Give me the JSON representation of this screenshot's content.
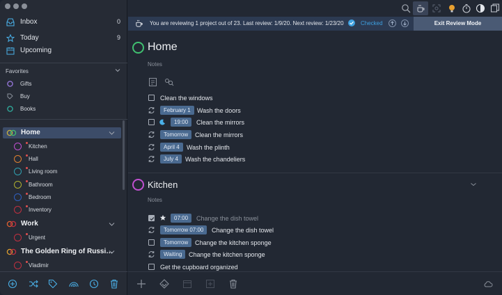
{
  "sidebar": {
    "top_items": [
      {
        "label": "Inbox",
        "count": "0"
      },
      {
        "label": "Today",
        "count": "9"
      },
      {
        "label": "Upcoming",
        "count": ""
      }
    ],
    "favorites_header": "Favorites",
    "favorites": [
      {
        "label": "Gifts",
        "color": "#9a7ae0"
      },
      {
        "label": "Buy",
        "color": "#8a909a"
      },
      {
        "label": "Books",
        "color": "#30b0a0"
      }
    ],
    "projects": [
      {
        "label": "Home",
        "sub": [
          {
            "label": "Kitchen",
            "color": "#c050d0"
          },
          {
            "label": "Hall",
            "color": "#e08030"
          },
          {
            "label": "Living room",
            "color": "#30a0b0"
          },
          {
            "label": "Bathroom",
            "color": "#b0b030"
          },
          {
            "label": "Bedroom",
            "color": "#3060c0"
          },
          {
            "label": "Inventory",
            "color": "#c03040"
          }
        ]
      },
      {
        "label": "Work",
        "sub": [
          {
            "label": "Urgent",
            "color": "#c03040"
          }
        ]
      },
      {
        "label": "The Golden Ring of Russi…",
        "sub": [
          {
            "label": "Vladimir",
            "color": "#c03040"
          }
        ]
      }
    ]
  },
  "review": {
    "text": "You are reviewing 1 project out of 23. Last review: 1/9/20. Next review: 1/23/20",
    "checked_label": "Checked",
    "exit_label": "Exit Review Mode"
  },
  "main": {
    "sections": [
      {
        "title": "Home",
        "notes": "Notes",
        "tasks": [
          {
            "type": "checkbox",
            "badge": "",
            "text": "Clean the windows"
          },
          {
            "type": "repeat",
            "badge": "February 1",
            "text": "Wash the doors"
          },
          {
            "type": "checkbox-moon",
            "badge": "19:00",
            "text": "Clean the mirrors"
          },
          {
            "type": "repeat",
            "badge": "Tomorrow",
            "text": "Clean the mirrors"
          },
          {
            "type": "repeat",
            "badge": "April 4",
            "text": "Wash the plinth"
          },
          {
            "type": "repeat",
            "badge": "July 4",
            "text": "Wash the chandeliers"
          }
        ]
      },
      {
        "title": "Kitchen",
        "notes": "Notes",
        "tasks": [
          {
            "type": "checked-star",
            "badge": "07:00",
            "text": "Change the dish towel"
          },
          {
            "type": "repeat",
            "badge": "Tomorrow 07:00",
            "text": "Change the dish towel"
          },
          {
            "type": "checkbox",
            "badge": "Tomorrow",
            "text": "Change the kitchen sponge"
          },
          {
            "type": "repeat",
            "badge": "Waiting",
            "text": "Change the kitchen sponge"
          },
          {
            "type": "checkbox",
            "badge": "",
            "text": "Get the cupboard organized"
          }
        ]
      }
    ]
  },
  "colors": {
    "accent": "#3ea0e0",
    "selected": "#3c4c68",
    "badge": "#4a6a90",
    "home_green": "#40c070"
  }
}
